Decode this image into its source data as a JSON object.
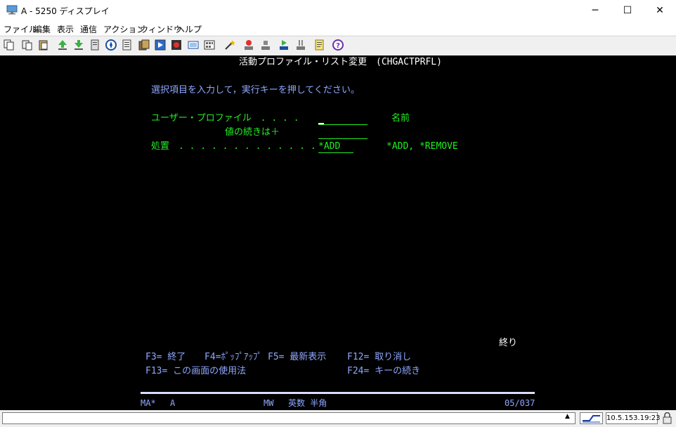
{
  "window": {
    "title": "A - 5250 ディスプレイ",
    "minimize_glyph": "─",
    "maximize_glyph": "☐",
    "close_glyph": "✕"
  },
  "menu": [
    "ファイル",
    "編集",
    "表示",
    "通信",
    "アクション",
    "ウィンドウ",
    "ヘルプ"
  ],
  "toolbar": {
    "icons": [
      "copy-icon",
      "paste-icon",
      "clipboard-icon",
      "upload-icon",
      "download-icon",
      "print-icon",
      "compass-icon",
      "notes-icon",
      "macro-icon",
      "play-macro-icon",
      "record-icon",
      "keyboard-icon",
      "keypad-icon",
      "wand-icon",
      "record-stop-icon",
      "stop-icon",
      "play-icon",
      "pause-icon",
      "note-icon",
      "help-icon"
    ]
  },
  "screen": {
    "title": "活動プロファイル・リスト変更　(CHGACTPRFL)",
    "instruction": "選択項目を入力して，実行キーを押してください。",
    "user_profile_label": "ユーザー・プロファイル　. . . .",
    "user_profile_value": "",
    "user_profile_hint": "名前",
    "more_values_label": "値の続きは＋",
    "disposition_label": "処置　. . . . . . . . . . . . .",
    "disposition_value": "*ADD",
    "disposition_hint": "*ADD, *REMOVE",
    "more_indicator": "終り",
    "fkeys_row1": [
      "F3= 終了",
      "F4=ﾎﾟｯﾌﾟｱｯﾌﾟ",
      "F5= 最新表示",
      "F12= 取り消し"
    ],
    "fkeys_row2": [
      "F13= この画面の使用法",
      "F24= キーの続き"
    ]
  },
  "oia": {
    "left": "MA*",
    "session": "A",
    "mode": "MW",
    "input_mode": "英数 半角",
    "cursor": "05/037"
  },
  "status": {
    "message": "",
    "dropdown_glyph": "▲",
    "ip": "10.5.153.19:23"
  },
  "colors": {
    "terminal_bg": "#000000",
    "white_text": "#ffffff",
    "blue_text": "#8fa8ff",
    "green_text": "#22ee22"
  }
}
